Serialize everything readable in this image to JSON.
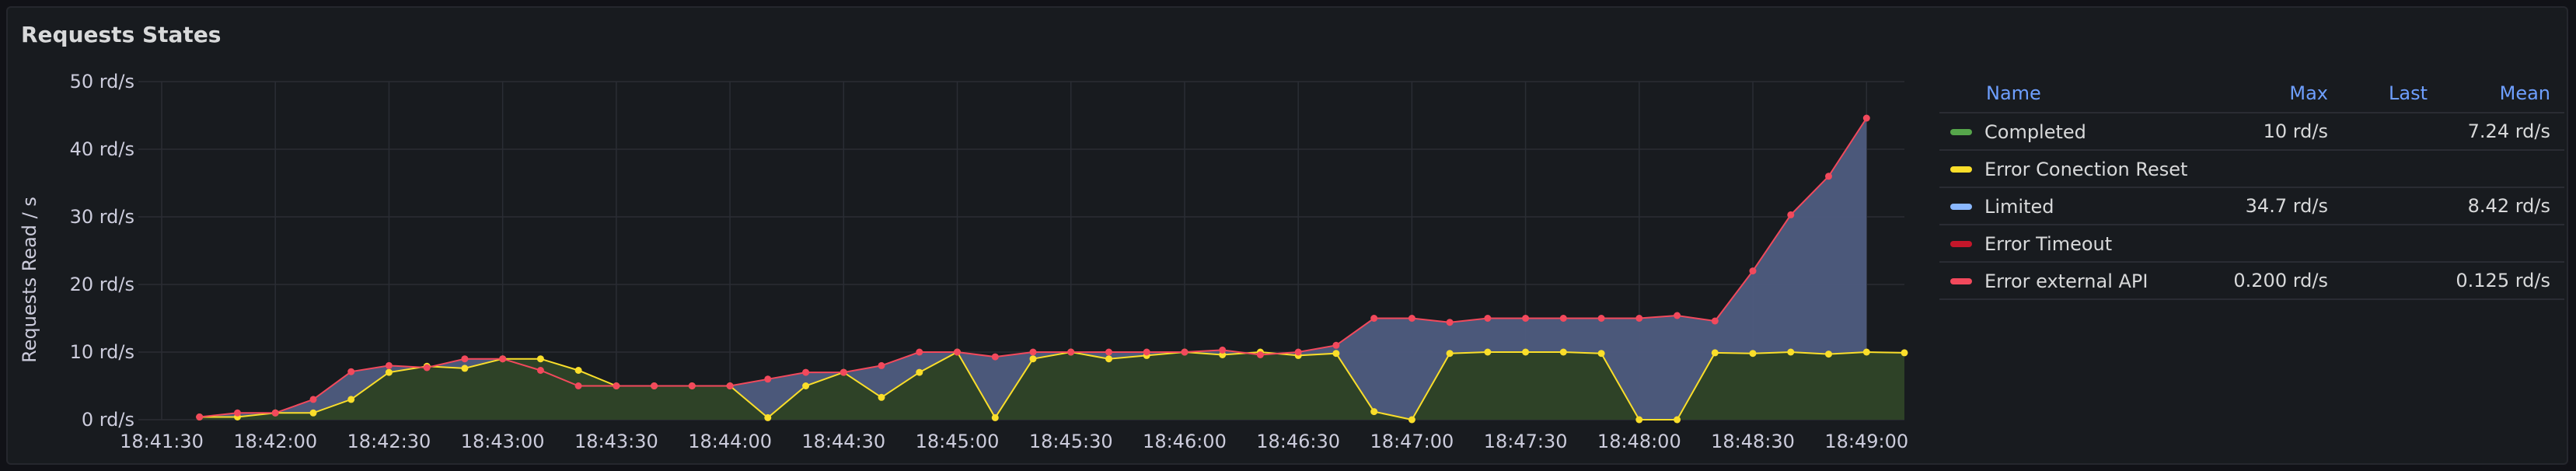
{
  "panel": {
    "title": "Requests States"
  },
  "chart_data": {
    "type": "area",
    "stacked": true,
    "ylabel": "Requests Read / s",
    "ylim": [
      0,
      50
    ],
    "y_ticks": [
      "0 rd/s",
      "10 rd/s",
      "20 rd/s",
      "30 rd/s",
      "40 rd/s",
      "50 rd/s"
    ],
    "y_tick_values": [
      0,
      10,
      20,
      30,
      40,
      50
    ],
    "x_ticks": [
      "18:41:30",
      "18:42:00",
      "18:42:30",
      "18:43:00",
      "18:43:30",
      "18:44:00",
      "18:44:30",
      "18:45:00",
      "18:45:30",
      "18:46:00",
      "18:46:30",
      "18:47:00",
      "18:47:30",
      "18:48:00",
      "18:48:30",
      "18:49:00"
    ],
    "x_start": "18:41:30",
    "x_end": "18:49:10",
    "grid": true,
    "series": [
      {
        "name": "Completed",
        "color": "#73bf69",
        "fill": "#2e4227",
        "points": [
          [
            "18:41:40",
            0.4
          ],
          [
            "18:41:50",
            0.4
          ],
          [
            "18:42:00",
            1
          ],
          [
            "18:42:10",
            1
          ],
          [
            "18:42:20",
            3
          ],
          [
            "18:42:30",
            7
          ],
          [
            "18:42:40",
            7.9
          ],
          [
            "18:42:50",
            7.6
          ],
          [
            "18:43:00",
            9
          ],
          [
            "18:43:10",
            9
          ],
          [
            "18:43:20",
            7.3
          ],
          [
            "18:43:30",
            5
          ],
          [
            "18:43:40",
            5
          ],
          [
            "18:43:50",
            5
          ],
          [
            "18:44:00",
            5
          ],
          [
            "18:44:10",
            0.3
          ],
          [
            "18:44:20",
            5
          ],
          [
            "18:44:30",
            7
          ],
          [
            "18:44:40",
            3.3
          ],
          [
            "18:44:50",
            7
          ],
          [
            "18:45:00",
            10
          ],
          [
            "18:45:10",
            0.3
          ],
          [
            "18:45:20",
            9
          ],
          [
            "18:45:30",
            10
          ],
          [
            "18:45:40",
            9
          ],
          [
            "18:45:50",
            9.5
          ],
          [
            "18:46:00",
            10
          ],
          [
            "18:46:10",
            9.6
          ],
          [
            "18:46:20",
            10
          ],
          [
            "18:46:30",
            9.5
          ],
          [
            "18:46:40",
            9.8
          ],
          [
            "18:46:50",
            1.2
          ],
          [
            "18:47:00",
            0
          ],
          [
            "18:47:10",
            9.8
          ],
          [
            "18:47:20",
            10
          ],
          [
            "18:47:30",
            10
          ],
          [
            "18:47:40",
            10
          ],
          [
            "18:47:50",
            9.8
          ],
          [
            "18:48:00",
            0
          ],
          [
            "18:48:10",
            0
          ],
          [
            "18:48:20",
            9.9
          ],
          [
            "18:48:30",
            9.8
          ],
          [
            "18:48:40",
            10
          ],
          [
            "18:48:50",
            9.7
          ],
          [
            "18:49:00",
            10
          ],
          [
            "18:49:10",
            9.9
          ]
        ]
      },
      {
        "name": "Error Conection Reset",
        "color": "#fade2a",
        "points": [
          [
            "18:41:40",
            0.4
          ],
          [
            "18:41:50",
            0.4
          ],
          [
            "18:42:00",
            1
          ],
          [
            "18:42:10",
            1
          ],
          [
            "18:42:20",
            3
          ],
          [
            "18:42:30",
            7
          ],
          [
            "18:42:40",
            7.9
          ],
          [
            "18:42:50",
            7.6
          ],
          [
            "18:43:00",
            9
          ],
          [
            "18:43:10",
            9
          ],
          [
            "18:43:20",
            7.3
          ],
          [
            "18:43:30",
            5
          ],
          [
            "18:43:40",
            5
          ],
          [
            "18:43:50",
            5
          ],
          [
            "18:44:00",
            5
          ],
          [
            "18:44:10",
            0.3
          ],
          [
            "18:44:20",
            5
          ],
          [
            "18:44:30",
            7
          ],
          [
            "18:44:40",
            3.3
          ],
          [
            "18:44:50",
            7
          ],
          [
            "18:45:00",
            10
          ],
          [
            "18:45:10",
            0.3
          ],
          [
            "18:45:20",
            9
          ],
          [
            "18:45:30",
            10
          ],
          [
            "18:45:40",
            9
          ],
          [
            "18:45:50",
            9.5
          ],
          [
            "18:46:00",
            10
          ],
          [
            "18:46:10",
            9.6
          ],
          [
            "18:46:20",
            10
          ],
          [
            "18:46:30",
            9.5
          ],
          [
            "18:46:40",
            9.8
          ],
          [
            "18:46:50",
            1.2
          ],
          [
            "18:47:00",
            0
          ],
          [
            "18:47:10",
            9.8
          ],
          [
            "18:47:20",
            10
          ],
          [
            "18:47:30",
            10
          ],
          [
            "18:47:40",
            10
          ],
          [
            "18:47:50",
            9.8
          ],
          [
            "18:48:00",
            0
          ],
          [
            "18:48:10",
            0
          ],
          [
            "18:48:20",
            9.9
          ],
          [
            "18:48:30",
            9.8
          ],
          [
            "18:48:40",
            10
          ],
          [
            "18:48:50",
            9.7
          ],
          [
            "18:49:00",
            10
          ],
          [
            "18:49:10",
            9.9
          ]
        ]
      },
      {
        "name": "Limited",
        "color": "#8ab8ff",
        "fill": "#4e5c7f",
        "points": [
          [
            "18:41:40",
            0.4
          ],
          [
            "18:41:50",
            1
          ],
          [
            "18:42:00",
            1
          ],
          [
            "18:42:10",
            3
          ],
          [
            "18:42:20",
            7.1
          ],
          [
            "18:42:30",
            8
          ],
          [
            "18:42:40",
            7.7
          ],
          [
            "18:42:50",
            9
          ],
          [
            "18:43:00",
            9
          ],
          [
            "18:43:10",
            7.3
          ],
          [
            "18:43:20",
            5
          ],
          [
            "18:43:30",
            5
          ],
          [
            "18:43:40",
            5
          ],
          [
            "18:43:50",
            5
          ],
          [
            "18:44:00",
            5
          ],
          [
            "18:44:10",
            6
          ],
          [
            "18:44:20",
            7
          ],
          [
            "18:44:30",
            7
          ],
          [
            "18:44:40",
            8
          ],
          [
            "18:44:50",
            10
          ],
          [
            "18:45:00",
            10
          ],
          [
            "18:45:10",
            9.3
          ],
          [
            "18:45:20",
            10
          ],
          [
            "18:45:30",
            10
          ],
          [
            "18:45:40",
            10
          ],
          [
            "18:45:50",
            10
          ],
          [
            "18:46:00",
            10
          ],
          [
            "18:46:10",
            10.3
          ],
          [
            "18:46:20",
            9.6
          ],
          [
            "18:46:30",
            10
          ],
          [
            "18:46:40",
            11
          ],
          [
            "18:46:50",
            15
          ],
          [
            "18:47:00",
            15
          ],
          [
            "18:47:10",
            14.4
          ],
          [
            "18:47:20",
            15
          ],
          [
            "18:47:30",
            15
          ],
          [
            "18:47:40",
            15
          ],
          [
            "18:47:50",
            15
          ],
          [
            "18:48:00",
            15
          ],
          [
            "18:48:10",
            15.4
          ],
          [
            "18:48:20",
            14.6
          ],
          [
            "18:48:30",
            22
          ],
          [
            "18:48:40",
            30.3
          ],
          [
            "18:48:50",
            36
          ],
          [
            "18:49:00",
            44.6
          ]
        ]
      },
      {
        "name": "Error Timeout",
        "color": "#c4162a",
        "points": []
      },
      {
        "name": "Error external API",
        "color": "#f2495c",
        "points": [
          [
            "18:41:40",
            0.4
          ],
          [
            "18:41:50",
            1
          ],
          [
            "18:42:00",
            1
          ],
          [
            "18:42:10",
            3
          ],
          [
            "18:42:20",
            7.1
          ],
          [
            "18:42:30",
            8
          ],
          [
            "18:42:40",
            7.7
          ],
          [
            "18:42:50",
            9
          ],
          [
            "18:43:00",
            9
          ],
          [
            "18:43:10",
            7.3
          ],
          [
            "18:43:20",
            5
          ],
          [
            "18:43:30",
            5
          ],
          [
            "18:43:40",
            5
          ],
          [
            "18:43:50",
            5
          ],
          [
            "18:44:00",
            5
          ],
          [
            "18:44:10",
            6
          ],
          [
            "18:44:20",
            7
          ],
          [
            "18:44:30",
            7
          ],
          [
            "18:44:40",
            8
          ],
          [
            "18:44:50",
            10
          ],
          [
            "18:45:00",
            10
          ],
          [
            "18:45:10",
            9.3
          ],
          [
            "18:45:20",
            10
          ],
          [
            "18:45:30",
            10
          ],
          [
            "18:45:40",
            10
          ],
          [
            "18:45:50",
            10
          ],
          [
            "18:46:00",
            10
          ],
          [
            "18:46:10",
            10.3
          ],
          [
            "18:46:20",
            9.6
          ],
          [
            "18:46:30",
            10
          ],
          [
            "18:46:40",
            11
          ],
          [
            "18:46:50",
            15
          ],
          [
            "18:47:00",
            15
          ],
          [
            "18:47:10",
            14.4
          ],
          [
            "18:47:20",
            15
          ],
          [
            "18:47:30",
            15
          ],
          [
            "18:47:40",
            15
          ],
          [
            "18:47:50",
            15
          ],
          [
            "18:48:00",
            15
          ],
          [
            "18:48:10",
            15.4
          ],
          [
            "18:48:20",
            14.6
          ],
          [
            "18:48:30",
            22
          ],
          [
            "18:48:40",
            30.3
          ],
          [
            "18:48:50",
            36
          ],
          [
            "18:49:00",
            44.6
          ]
        ]
      }
    ]
  },
  "legend": {
    "headers": {
      "name": "Name",
      "max": "Max",
      "last": "Last",
      "mean": "Mean"
    },
    "rows": [
      {
        "name": "Completed",
        "color": "#56a64b",
        "max": "10 rd/s",
        "last": "",
        "mean": "7.24 rd/s"
      },
      {
        "name": "Error Conection Reset",
        "color": "#fade2a",
        "max": "",
        "last": "",
        "mean": ""
      },
      {
        "name": "Limited",
        "color": "#8ab8ff",
        "max": "34.7 rd/s",
        "last": "",
        "mean": "8.42 rd/s"
      },
      {
        "name": "Error Timeout",
        "color": "#c4162a",
        "max": "",
        "last": "",
        "mean": ""
      },
      {
        "name": "Error external API",
        "color": "#f2495c",
        "max": "0.200 rd/s",
        "last": "",
        "mean": "0.125 rd/s"
      }
    ]
  }
}
